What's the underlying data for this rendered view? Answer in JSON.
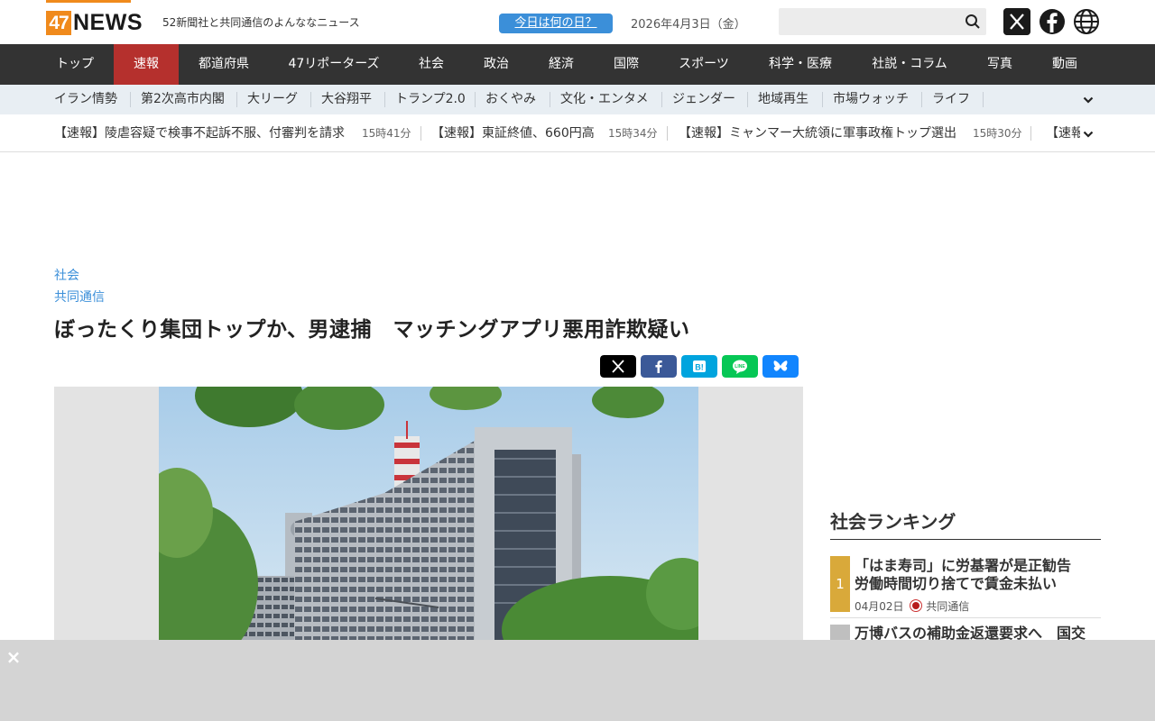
{
  "header": {
    "logo_number": "47",
    "logo_word": "NEWS",
    "tagline": "52新聞社と共同通信のよんななニュース",
    "today_button": "今日は何の日？",
    "date": "2026年4月3日（金）",
    "search_placeholder": ""
  },
  "nav": {
    "items": [
      "トップ",
      "速報",
      "都道府県",
      "47リポーターズ",
      "社会",
      "政治",
      "経済",
      "国際",
      "スポーツ",
      "科学・医療",
      "社説・コラム",
      "写真",
      "動画"
    ],
    "active_index": 1
  },
  "subnav": {
    "items": [
      "イラン情勢",
      "第2次高市内閣",
      "大リーグ",
      "大谷翔平",
      "トランプ2.0",
      "おくやみ",
      "文化・エンタメ",
      "ジェンダー",
      "地域再生",
      "市場ウォッチ",
      "ライフ"
    ]
  },
  "ticker": [
    {
      "text": "【速報】陵虐容疑で検事不起訴不服、付審判を請求",
      "time": "15時41分"
    },
    {
      "text": "【速報】東証終値、660円高",
      "time": "15時34分"
    },
    {
      "text": "【速報】ミャンマー大統領に軍事政権トップ選出",
      "time": "15時30分"
    },
    {
      "text": "【速報",
      "time": ""
    }
  ],
  "article": {
    "category": "社会",
    "source": "共同通信",
    "headline": "ぼったくり集団トップか、男逮捕　マッチングアプリ悪用詐欺疑い"
  },
  "share_buttons": [
    {
      "name": "x",
      "color": "#000000"
    },
    {
      "name": "facebook",
      "color": "#3b5998"
    },
    {
      "name": "hatena",
      "color": "#00a4de"
    },
    {
      "name": "line",
      "color": "#06c755"
    },
    {
      "name": "bluesky",
      "color": "#1185fe"
    }
  ],
  "ranking": {
    "title": "社会ランキング",
    "items": [
      {
        "rank": "1",
        "text": "「はま寿司」に労基署が是正勧告　労働時間切り捨てで賃金未払い",
        "date": "04月02日",
        "source": "共同通信"
      },
      {
        "rank": "",
        "text": "万博バスの補助金返還要求へ　国交",
        "date": "",
        "source": ""
      }
    ]
  },
  "ad": {
    "close": "×"
  },
  "colors": {
    "accent_orange": "#f08a1c",
    "nav_bg": "#333333",
    "nav_active": "#b5302d",
    "link_blue": "#3b8fd9",
    "rank_gold": "#d9a93a"
  }
}
